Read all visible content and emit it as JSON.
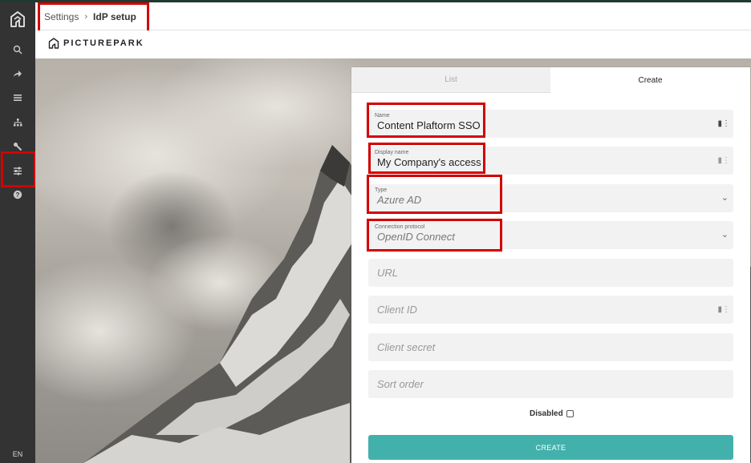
{
  "header": {
    "breadcrumb_parent": "Settings",
    "breadcrumb_current": "IdP setup"
  },
  "brand": {
    "name": "PICTUREPARK"
  },
  "rail": {
    "icons": [
      "search-icon",
      "share-icon",
      "list-icon",
      "hierarchy-icon",
      "wrench-icon",
      "settings-sliders-icon",
      "help-icon"
    ],
    "language": "EN"
  },
  "tabs": {
    "list": "List",
    "create": "Create"
  },
  "form": {
    "name": {
      "label": "Name",
      "value": "Content Plaftorm SSO"
    },
    "display_name": {
      "label": "Display name",
      "value": "My Company's access"
    },
    "type": {
      "label": "Type",
      "value": "Azure AD"
    },
    "protocol": {
      "label": "Connection protocol",
      "value": "OpenID Connect"
    },
    "url": {
      "placeholder": "URL"
    },
    "client_id": {
      "placeholder": "Client ID"
    },
    "client_secret": {
      "placeholder": "Client secret"
    },
    "sort_order": {
      "placeholder": "Sort order"
    },
    "disabled_label": "Disabled",
    "disabled_checked": false,
    "create_button": "CREATE"
  },
  "colors": {
    "highlight": "#d40000",
    "primary_button": "#43b1ab",
    "rail": "#333333"
  }
}
